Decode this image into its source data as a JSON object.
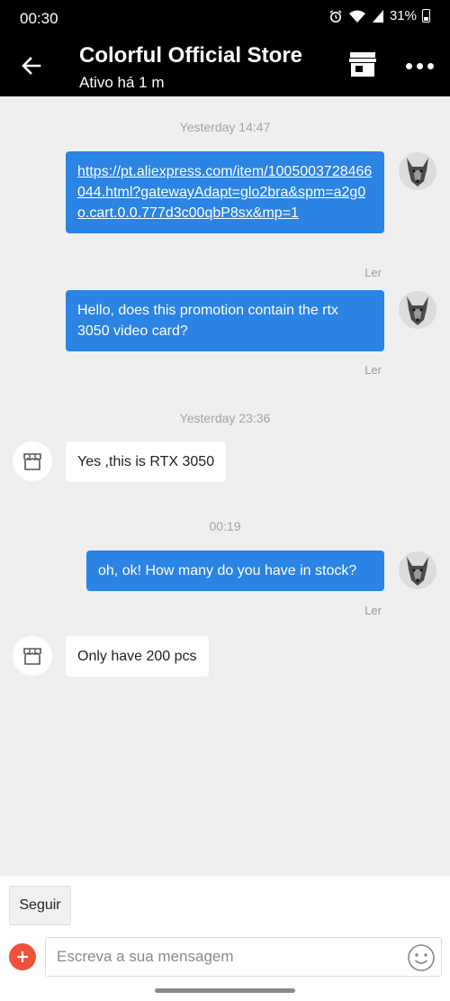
{
  "status_bar": {
    "time": "00:30",
    "battery": "31%",
    "icons": [
      "alarm-icon",
      "wifi-icon",
      "signal-icon",
      "battery-icon"
    ]
  },
  "header": {
    "title": "Colorful Official Store",
    "status": "Ativo há 1 m",
    "icons": [
      "back-arrow-icon",
      "store-icon",
      "more-icon"
    ]
  },
  "colors": {
    "header_bg": "#000000",
    "chat_bg": "#efefef",
    "outgoing_bubble": "#2b83e4",
    "incoming_bubble": "#ffffff",
    "add_button": "#f0503c"
  },
  "messages": {
    "timestamp_1": "Yesterday 14:47",
    "msg_1_link": "https://pt.aliexpress.com/item/1005003728466044.html?gatewayAdapt=glo2bra&spm=a2g0o.cart.0.0.777d3c00qbP8sx&mp=1",
    "msg_1_status": "Ler",
    "msg_2": "Hello, does this promotion contain the rtx 3050 video card?",
    "msg_2_status": "Ler",
    "timestamp_2": "Yesterday 23:36",
    "msg_3": "Yes ,this is RTX 3050",
    "timestamp_3": "00:19",
    "msg_4": "oh, ok! How many do you have in stock?",
    "msg_4_status": "Ler",
    "msg_5": "Only have 200 pcs"
  },
  "footer": {
    "follow_label": "Seguir",
    "input_placeholder": "Escreva a sua mensagem",
    "icons": [
      "add-icon",
      "emoji-icon"
    ]
  }
}
